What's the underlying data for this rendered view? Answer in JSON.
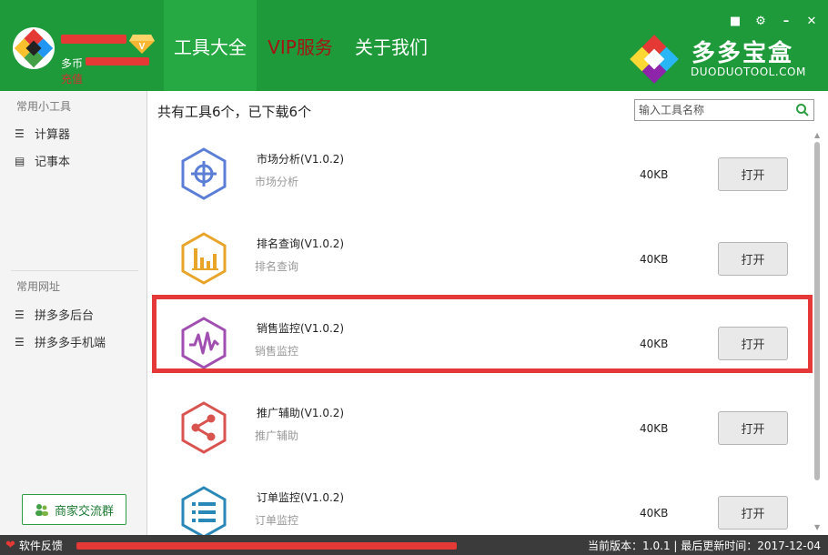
{
  "header": {
    "user": {
      "coins_label": "多币",
      "recharge_label": "充值"
    },
    "nav": [
      {
        "label": "工具大全",
        "active": true
      },
      {
        "label": "VIP服务",
        "active": false
      },
      {
        "label": "关于我们",
        "active": false
      }
    ],
    "window_controls": [
      "shirt-icon",
      "gear-icon",
      "minimize-icon",
      "close-icon"
    ],
    "brand": {
      "name": "多多宝盒",
      "url": "DUODUOTOOL.COM"
    }
  },
  "sidebar": {
    "tools_title": "常用小工具",
    "tools": [
      {
        "label": "计算器",
        "icon": "list-icon"
      },
      {
        "label": "记事本",
        "icon": "monitor-icon"
      }
    ],
    "sites_title": "常用网址",
    "sites": [
      {
        "label": "拼多多后台",
        "icon": "list-icon"
      },
      {
        "label": "拼多多手机端",
        "icon": "list-icon"
      }
    ],
    "group_button": "商家交流群"
  },
  "main": {
    "summary": "共有工具6个，已下载6个",
    "search_placeholder": "输入工具名称",
    "tools": [
      {
        "name": "市场分析(V1.0.2)",
        "desc": "市场分析",
        "size": "40KB",
        "button": "打开",
        "icon": "target-icon",
        "color": "#5b7fd6"
      },
      {
        "name": "排名查询(V1.0.2)",
        "desc": "排名查询",
        "size": "40KB",
        "button": "打开",
        "icon": "bar-chart-icon",
        "color": "#e8a52a"
      },
      {
        "name": "销售监控(V1.0.2)",
        "desc": "销售监控",
        "size": "40KB",
        "button": "打开",
        "icon": "pulse-icon",
        "color": "#a04fb0"
      },
      {
        "name": "推广辅助(V1.0.2)",
        "desc": "推广辅助",
        "size": "40KB",
        "button": "打开",
        "icon": "share-icon",
        "color": "#d9534f"
      },
      {
        "name": "订单监控(V1.0.2)",
        "desc": "订单监控",
        "size": "40KB",
        "button": "打开",
        "icon": "list-icon",
        "color": "#2a88b8"
      }
    ]
  },
  "statusbar": {
    "feedback": "软件反馈",
    "version": "当前版本：1.0.1 | 最后更新时间：2017-12-04"
  }
}
